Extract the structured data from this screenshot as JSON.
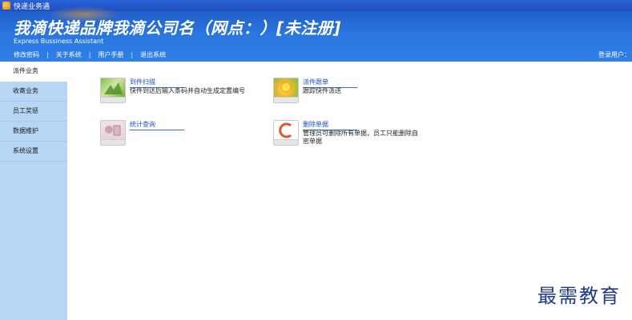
{
  "window": {
    "title": "快递业务通"
  },
  "header": {
    "title": "我滴快递品牌我滴公司名（网点：）[未注册]",
    "subtitle": "Express Bussiness Assistant",
    "nav": [
      "修改密码",
      "关于系统",
      "用户手册",
      "退出系统"
    ],
    "login_user": "登录用户："
  },
  "sidebar": {
    "items": [
      {
        "label": "派件业务"
      },
      {
        "label": "收寄业务"
      },
      {
        "label": "员工奖惩"
      },
      {
        "label": "数据维护"
      },
      {
        "label": "系统设置"
      }
    ]
  },
  "main": {
    "tiles": [
      {
        "title": "到件扫描",
        "desc": "快件到达后输入条码并自动生成定置编号",
        "icon": "scan-icon"
      },
      {
        "title": "派件跟单",
        "desc": "跟踪快件派送",
        "icon": "track-icon"
      },
      {
        "title": "统计查询",
        "desc": "",
        "icon": "stats-icon"
      },
      {
        "title": "删除单据",
        "desc": "管理员可删除所有单据，员工只能删除自密单据",
        "icon": "delete-icon"
      }
    ]
  },
  "watermark": "最需教育"
}
